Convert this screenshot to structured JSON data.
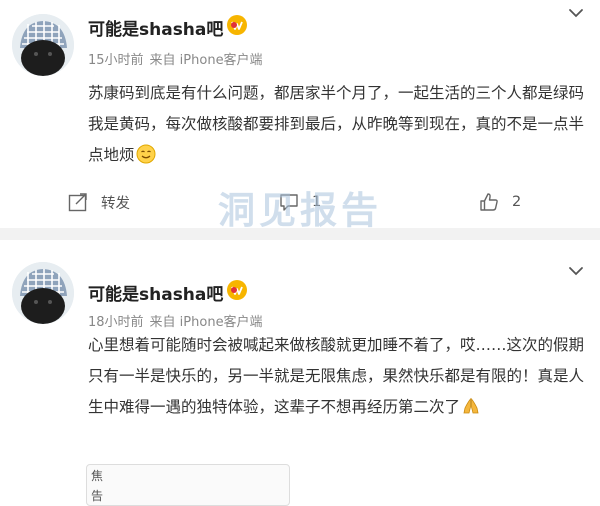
{
  "posts": [
    {
      "username": "可能是shasha吧",
      "time": "15小时前",
      "source": "来自 iPhone客户端",
      "content": "苏康码到底是有什么问题，都居家半个月了，一起生活的三个人都是绿码我是黄码，每次做核酸都要排到最后，从昨晚等到现在，真的不是一点半点地烦",
      "content_emoji": "smile-emoji",
      "actions": {
        "repost_label": "转发",
        "comment_count": "1",
        "like_count": "2"
      }
    },
    {
      "username": "可能是shasha吧",
      "time": "18小时前",
      "source": "来自 iPhone客户端",
      "content": "心里想着可能随时会被喊起来做核酸就更加睡不着了，哎……这次的假期只有一半是快乐的，另一半就是无限焦虑，果然快乐都是有限的！真是人生中难得一遇的独特体验，这辈子不想再经历第二次了",
      "content_emoji": "pray-emoji",
      "attachment_text": [
        "焦",
        "告"
      ]
    }
  ],
  "watermark": "洞见报告",
  "colors": {
    "text": "#333333",
    "meta": "#888888",
    "separator": "#f2f2f2",
    "watermark": "#aac3dc"
  },
  "icons": [
    "avatar",
    "vip-badge-icon",
    "chevron-down-icon",
    "repost-icon",
    "comment-icon",
    "like-icon"
  ]
}
